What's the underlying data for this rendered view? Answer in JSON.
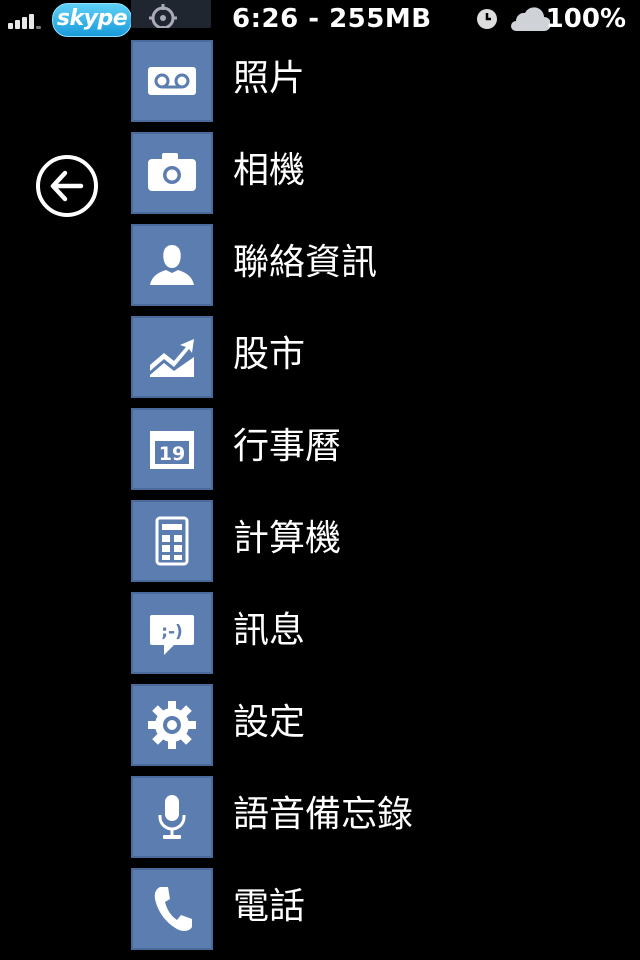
{
  "status_bar": {
    "carrier": "skype",
    "time_memory": "6:26 - 255MB",
    "battery": "100%"
  },
  "back_button": {
    "icon": "back-arrow-icon"
  },
  "apps": [
    {
      "label": "照片",
      "icon": "voicemail-icon"
    },
    {
      "label": "相機",
      "icon": "camera-icon"
    },
    {
      "label": "聯絡資訊",
      "icon": "contact-icon"
    },
    {
      "label": "股市",
      "icon": "stocks-icon"
    },
    {
      "label": "行事曆",
      "icon": "calendar-icon",
      "badge": "19"
    },
    {
      "label": "計算機",
      "icon": "calculator-icon"
    },
    {
      "label": "訊息",
      "icon": "message-icon",
      "badge": ";-)"
    },
    {
      "label": "設定",
      "icon": "gear-icon"
    },
    {
      "label": "語音備忘錄",
      "icon": "microphone-icon"
    },
    {
      "label": "電話",
      "icon": "phone-icon"
    }
  ],
  "colors": {
    "tile": "#5b7db0",
    "background": "#000000",
    "text": "#ffffff"
  }
}
